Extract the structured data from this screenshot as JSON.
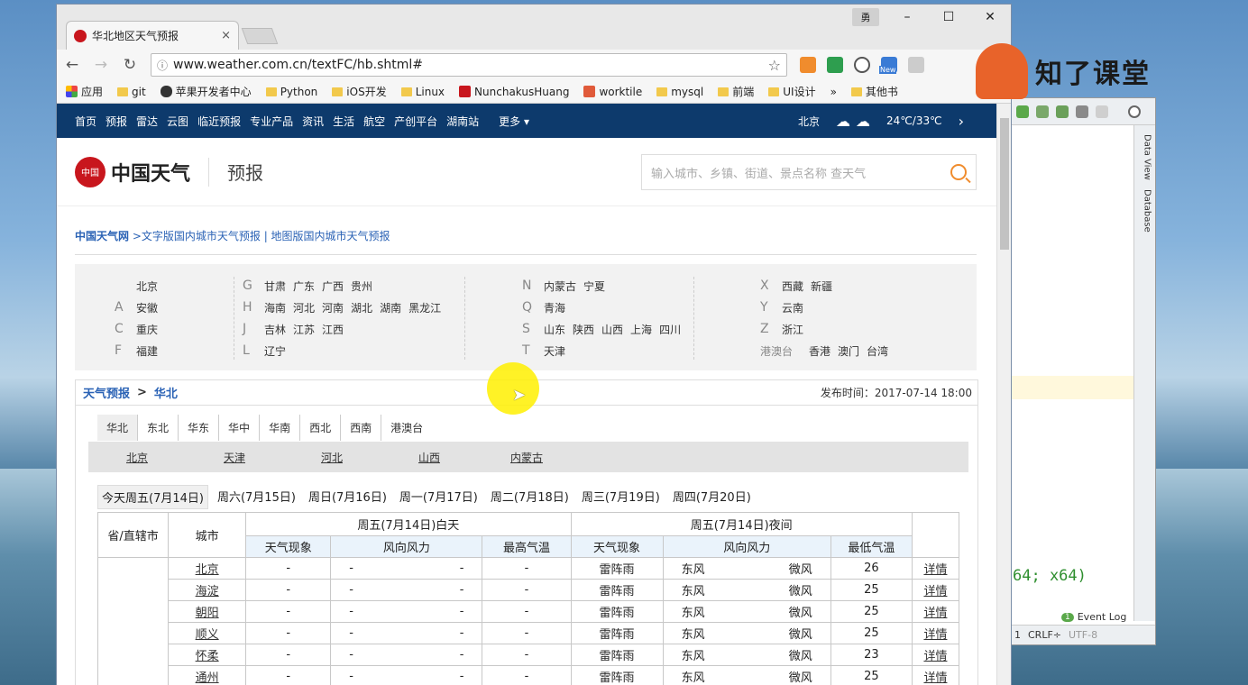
{
  "browser": {
    "tab_title": "华北地区天气预报",
    "tab_close": "×",
    "user_badge": "勇",
    "win_controls": [
      "–",
      "☐",
      "✕"
    ],
    "url": "www.weather.com.cn/textFC/hb.shtml#",
    "bookmarks": [
      "应用",
      "git",
      "苹果开发者中心",
      "Python",
      "iOS开发",
      "Linux",
      "NunchakusHuang",
      "worktile",
      "mysql",
      "前端",
      "UI设计",
      "»",
      "其他书"
    ],
    "ext_new_badge": "New"
  },
  "watermark": {
    "text": "知了课堂"
  },
  "ide": {
    "side_labels": [
      "Data View",
      "Database"
    ],
    "code_line": "64; x64)",
    "event_count": "1",
    "event_log": "Event Log",
    "status_items": [
      "1",
      "CRLF÷",
      "UTF-8"
    ]
  },
  "site": {
    "nav_links": [
      "首页",
      "预报",
      "雷达",
      "云图",
      "临近预报",
      "专业产品",
      "资讯",
      "生活",
      "航空",
      "产创平台",
      "湖南站"
    ],
    "nav_more": "更多 ▾",
    "nav_city": "北京",
    "nav_temp": "24℃/33℃",
    "logo_seal": "中国",
    "logo_text": "中国天气",
    "logo_sub": "预报",
    "search_placeholder": "输入城市、乡镇、街道、景点名称 查天气",
    "crumb_home": "中国天气网",
    "crumb_rest": " >文字版国内城市天气预报 | 地图版国内城市天气预报"
  },
  "regions": {
    "col1": [
      {
        "l": "",
        "c": [
          "北京"
        ]
      },
      {
        "l": "A",
        "c": [
          "安徽"
        ]
      },
      {
        "l": "C",
        "c": [
          "重庆"
        ]
      },
      {
        "l": "F",
        "c": [
          "福建"
        ]
      }
    ],
    "col2": [
      {
        "l": "G",
        "c": [
          "甘肃",
          "广东",
          "广西",
          "贵州"
        ]
      },
      {
        "l": "H",
        "c": [
          "海南",
          "河北",
          "河南",
          "湖北",
          "湖南",
          "黑龙江"
        ]
      },
      {
        "l": "J",
        "c": [
          "吉林",
          "江苏",
          "江西"
        ]
      },
      {
        "l": "L",
        "c": [
          "辽宁"
        ]
      }
    ],
    "col3": [
      {
        "l": "N",
        "c": [
          "内蒙古",
          "宁夏"
        ]
      },
      {
        "l": "Q",
        "c": [
          "青海"
        ]
      },
      {
        "l": "S",
        "c": [
          "山东",
          "陕西",
          "山西",
          "上海",
          "四川"
        ]
      },
      {
        "l": "T",
        "c": [
          "天津"
        ]
      }
    ],
    "col4": [
      {
        "l": "X",
        "c": [
          "西藏",
          "新疆"
        ]
      },
      {
        "l": "Y",
        "c": [
          "云南"
        ]
      },
      {
        "l": "Z",
        "c": [
          "浙江"
        ]
      },
      {
        "l": "港澳台",
        "c": [
          "香港",
          "澳门",
          "台湾"
        ]
      }
    ]
  },
  "forecast": {
    "crumb_a": "天气预报",
    "crumb_sep": ">",
    "crumb_b": "华北",
    "published": "发布时间：2017-07-14 18:00",
    "area_tabs": [
      "华北",
      "东北",
      "华东",
      "华中",
      "华南",
      "西北",
      "西南",
      "港澳台"
    ],
    "provinces": [
      "北京",
      "天津",
      "河北",
      "山西",
      "内蒙古"
    ],
    "day_tabs": [
      "今天周五(7月14日)",
      "周六(7月15日)",
      "周日(7月16日)",
      "周一(7月17日)",
      "周二(7月18日)",
      "周三(7月19日)",
      "周四(7月20日)"
    ],
    "table": {
      "h_prov": "省/直辖市",
      "h_city": "城市",
      "h_day": "周五(7月14日)白天",
      "h_night": "周五(7月14日)夜间",
      "h_sub": [
        "天气现象",
        "风向风力",
        "最高气温",
        "天气现象",
        "风向风力",
        "最低气温"
      ],
      "rows": [
        {
          "city": "北京",
          "d_w": "-",
          "d_wd": "-",
          "d_wf": "-",
          "d_t": "-",
          "n_w": "雷阵雨",
          "n_wd": "东风",
          "n_wf": "微风",
          "n_t": "26",
          "det": "详情"
        },
        {
          "city": "海淀",
          "d_w": "-",
          "d_wd": "-",
          "d_wf": "-",
          "d_t": "-",
          "n_w": "雷阵雨",
          "n_wd": "东风",
          "n_wf": "微风",
          "n_t": "25",
          "det": "详情"
        },
        {
          "city": "朝阳",
          "d_w": "-",
          "d_wd": "-",
          "d_wf": "-",
          "d_t": "-",
          "n_w": "雷阵雨",
          "n_wd": "东风",
          "n_wf": "微风",
          "n_t": "25",
          "det": "详情"
        },
        {
          "city": "顺义",
          "d_w": "-",
          "d_wd": "-",
          "d_wf": "-",
          "d_t": "-",
          "n_w": "雷阵雨",
          "n_wd": "东风",
          "n_wf": "微风",
          "n_t": "25",
          "det": "详情"
        },
        {
          "city": "怀柔",
          "d_w": "-",
          "d_wd": "-",
          "d_wf": "-",
          "d_t": "-",
          "n_w": "雷阵雨",
          "n_wd": "东风",
          "n_wf": "微风",
          "n_t": "23",
          "det": "详情"
        },
        {
          "city": "通州",
          "d_w": "-",
          "d_wd": "-",
          "d_wf": "-",
          "d_t": "-",
          "n_w": "雷阵雨",
          "n_wd": "东风",
          "n_wf": "微风",
          "n_t": "25",
          "det": "详情"
        }
      ]
    }
  }
}
